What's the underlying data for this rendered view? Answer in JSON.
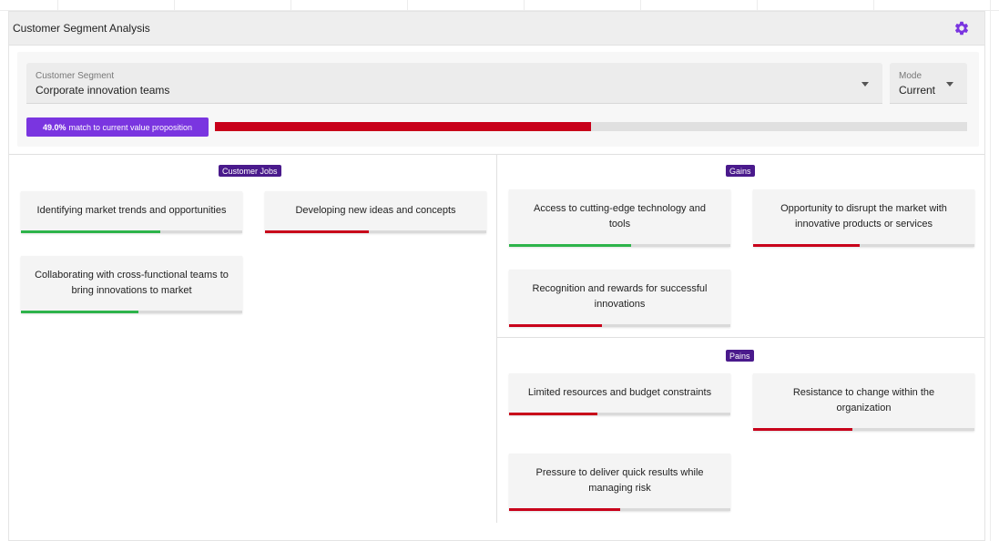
{
  "header": {
    "title": "Customer Segment Analysis",
    "settings_icon": "gear-icon",
    "accent": "#7a35e0"
  },
  "controls": {
    "segment": {
      "label": "Customer Segment",
      "value": "Corporate innovation teams"
    },
    "mode": {
      "label": "Mode",
      "value": "Current"
    },
    "match": {
      "percent": "49.0%",
      "text": "match to current value proposition",
      "fraction": 0.5
    }
  },
  "sections": {
    "jobs": {
      "tag": "Customer Jobs"
    },
    "gains": {
      "tag": "Gains"
    },
    "pains": {
      "tag": "Pains"
    }
  },
  "cards": [
    {
      "text": "Identifying market trends and opportunities",
      "fill": 0.63,
      "color": "green"
    },
    {
      "text": "Developing new ideas and concepts",
      "fill": 0.47,
      "color": "red"
    },
    {
      "text": "Collaborating with cross-functional teams to bring innovations to market",
      "fill": 0.53,
      "color": "green"
    },
    {
      "text": "Access to cutting-edge technology and tools",
      "fill": 0.55,
      "color": "green"
    },
    {
      "text": "Opportunity to disrupt the market with innovative products or services",
      "fill": 0.48,
      "color": "red"
    },
    {
      "text": "Recognition and rewards for successful innovations",
      "fill": 0.42,
      "color": "red"
    },
    {
      "text": "Limited resources and budget constraints",
      "fill": 0.4,
      "color": "red"
    },
    {
      "text": "Resistance to change within the organization",
      "fill": 0.45,
      "color": "red"
    },
    {
      "text": "Pressure to deliver quick results while managing risk",
      "fill": 0.5,
      "color": "red"
    }
  ],
  "colors": {
    "green": "#2db34a",
    "red": "#c8001a",
    "tag": "#4a1a8c"
  }
}
